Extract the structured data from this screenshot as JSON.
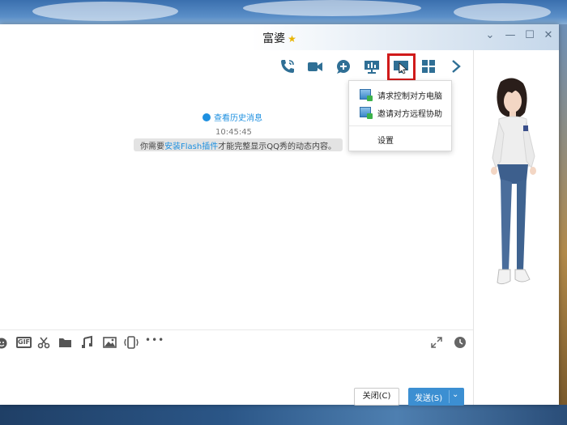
{
  "window": {
    "title": "富婆",
    "controls": [
      "chevron-down-icon",
      "minimize-icon",
      "maximize-icon",
      "close-icon"
    ]
  },
  "toolbar": {
    "icons": [
      "phone-icon",
      "video-call-icon",
      "add-chat-icon",
      "screen-share-icon",
      "remote-assist-icon",
      "app-grid-icon",
      "chevron-right-icon"
    ],
    "highlighted": "remote-assist-icon"
  },
  "chat": {
    "history_link": "查看历史消息",
    "timestamp": "10:45:45",
    "notice_prefix": "你需要",
    "notice_link": "安装Flash插件",
    "notice_suffix": "才能完整显示QQ秀的动态内容。"
  },
  "dropdown": {
    "items": [
      {
        "label": "请求控制对方电脑",
        "icon": "remote-control-icon"
      },
      {
        "label": "邀请对方远程协助",
        "icon": "remote-help-icon"
      },
      {
        "label": "设置"
      }
    ]
  },
  "input_toolbar": {
    "icons": [
      "emoji-icon",
      "gif-icon",
      "scissors-icon",
      "folder-icon",
      "music-icon",
      "image-icon",
      "shake-icon",
      "more-icon",
      "expand-icon",
      "history-clock-icon"
    ],
    "gif_label": "GIF",
    "more_label": "•••"
  },
  "buttons": {
    "close_label": "关闭(C)",
    "send_label": "发送(S)"
  },
  "colors": {
    "accent": "#3c8fd2",
    "link": "#1e90e0",
    "highlight": "#d01a1a",
    "toolbar_icon": "#2f6f95"
  }
}
